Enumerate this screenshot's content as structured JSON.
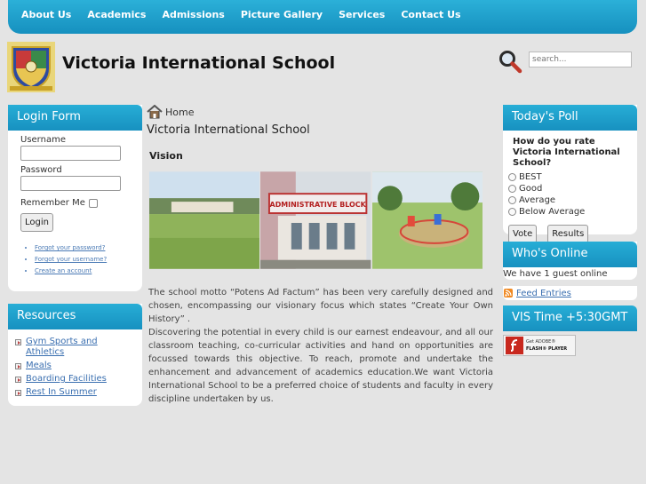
{
  "nav": {
    "items": [
      "About Us",
      "Academics",
      "Admissions",
      "Picture Gallery",
      "Services",
      "Contact Us"
    ]
  },
  "header": {
    "title": "Victoria International School",
    "search_placeholder": "search..."
  },
  "login": {
    "heading": "Login Form",
    "username_label": "Username",
    "password_label": "Password",
    "remember_label": "Remember Me",
    "button": "Login",
    "links": [
      "Forgot your password?",
      "Forgot your username?",
      "Create an account"
    ]
  },
  "resources": {
    "heading": "Resources",
    "items": [
      "Gym Sports and Athletics",
      "Meals",
      "Boarding Facilities",
      "Rest In Summer"
    ]
  },
  "main": {
    "breadcrumb": "Home",
    "heading": "Victoria International School",
    "subheading": "Vision",
    "paragraph1": "The school motto “Potens Ad Factum” has been very carefully designed and chosen, encompassing our visionary focus which states “Create Your Own History” .",
    "paragraph2": "Discovering the potential in every child is our earnest endeavour, and all our classroom teaching, co-curricular activities and hand on opportunities are focussed towards this objective. To reach, promote and undertake the enhancement and advancement of academics education.We want Victoria International  School to be a preferred choice of students and faculty in every discipline undertaken by us.",
    "gallery_sign": "ADMINISTRATIVE BLOCK"
  },
  "poll": {
    "heading": "Today's Poll",
    "question": "How do you rate Victoria International School?",
    "options": [
      "BEST",
      "Good",
      "Average",
      "Below Average"
    ],
    "vote_button": "Vote",
    "results_button": "Results"
  },
  "online": {
    "heading": "Who's Online",
    "text": "We have 1 guest online"
  },
  "feed": {
    "label": "Feed Entries"
  },
  "vistime": {
    "heading": "VIS Time +5:30GMT",
    "flash_line1": "Get ADOBE®",
    "flash_line2": "FLASH® PLAYER"
  },
  "colors": {
    "accent": "#1a9ccc",
    "link": "#3a6fb0"
  }
}
